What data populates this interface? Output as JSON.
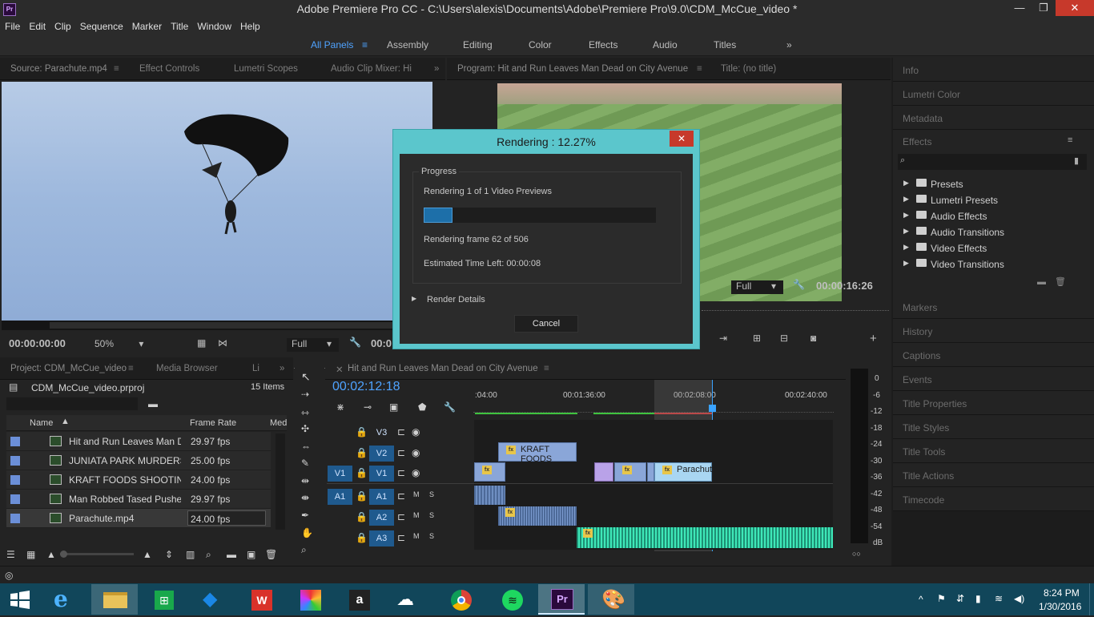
{
  "window": {
    "title": "Adobe Premiere Pro CC - C:\\Users\\alexis\\Documents\\Adobe\\Premiere Pro\\9.0\\CDM_McCue_video *",
    "logo": "Pr"
  },
  "menu": [
    "File",
    "Edit",
    "Clip",
    "Sequence",
    "Marker",
    "Title",
    "Window",
    "Help"
  ],
  "workspaces": {
    "all_panels": "All Panels",
    "items": [
      "Assembly",
      "Editing",
      "Color",
      "Effects",
      "Audio",
      "Titles"
    ],
    "more": "»"
  },
  "source_panel": {
    "tabs": [
      "Source: Parachute.mp4",
      "Effect Controls",
      "Lumetri Scopes",
      "Audio Clip Mixer: Hi"
    ],
    "timecode": "00:00:00:00",
    "zoom": "50%",
    "quality": "Full",
    "timecode_right": "00:0"
  },
  "program_panel": {
    "tabs": [
      "Program: Hit and Run Leaves Man Dead on City Avenue",
      "Title: (no title)"
    ],
    "quality": "Full",
    "timecode": "00:00:16:26"
  },
  "right_panels": {
    "items_top": [
      "Info",
      "Lumetri Color",
      "Metadata"
    ],
    "effects": {
      "title": "Effects",
      "folders": [
        "Presets",
        "Lumetri Presets",
        "Audio Effects",
        "Audio Transitions",
        "Video Effects",
        "Video Transitions"
      ]
    },
    "items_bottom": [
      "Markers",
      "History",
      "Captions",
      "Events",
      "Title Properties",
      "Title Styles",
      "Title Tools",
      "Title Actions",
      "Timecode"
    ]
  },
  "project_panel": {
    "tabs": [
      "Project: CDM_McCue_video",
      "Media Browser",
      "Li"
    ],
    "file": "CDM_McCue_video.prproj",
    "count": "15 Items",
    "columns": [
      "Name",
      "Frame Rate",
      "Med"
    ],
    "rows": [
      {
        "name": "Hit and Run Leaves Man De",
        "fps": "29.97 fps"
      },
      {
        "name": "JUNIATA PARK MURDERS -",
        "fps": "25.00 fps"
      },
      {
        "name": "KRAFT FOODS SHOOTING-",
        "fps": "24.00 fps"
      },
      {
        "name": "Man Robbed Tased Pushed",
        "fps": "29.97 fps"
      },
      {
        "name": "Parachute.mp4",
        "fps": "24.00 fps"
      }
    ]
  },
  "timeline": {
    "tab": "Hit and Run Leaves Man Dead on City Avenue",
    "timecode": "00:02:12:18",
    "ticks": [
      ":04:00",
      "00:01:36:00",
      "00:02:08:00",
      "00:02:40:00"
    ],
    "tracks": [
      {
        "src": "",
        "name": "V3"
      },
      {
        "src": "",
        "name": "V2"
      },
      {
        "src": "V1",
        "name": "V1"
      },
      {
        "src": "A1",
        "name": "A1"
      },
      {
        "src": "",
        "name": "A2"
      },
      {
        "src": "",
        "name": "A3"
      }
    ],
    "audio_labels": {
      "m": "M",
      "s": "S"
    },
    "clips": {
      "kraft": "KRAFT FOODS",
      "parachute": "Parachut",
      "fx": "fx"
    }
  },
  "meter": {
    "scale": [
      "0",
      "-6",
      "-12",
      "-18",
      "-24",
      "-30",
      "-36",
      "-42",
      "-48",
      "-54",
      "dB"
    ]
  },
  "dialog": {
    "title": "Rendering : 12.27%",
    "group": "Progress",
    "status": "Rendering 1 of 1 Video Previews",
    "progress": 0.1227,
    "frame": "Rendering frame 62 of 506",
    "eta": "Estimated Time Left: 00:00:08",
    "details": "Render Details",
    "cancel": "Cancel",
    "close": "✕"
  },
  "taskbar": {
    "time": "8:24 PM",
    "date": "1/30/2016",
    "premiere_label": "Pr"
  },
  "colors": {
    "accent": "#5bc6cc",
    "progress": "#1d6fa9",
    "track_label": "#1f5a8e",
    "audio_clip": "#3ee8b8",
    "video_clip": "#8aa6d8"
  }
}
